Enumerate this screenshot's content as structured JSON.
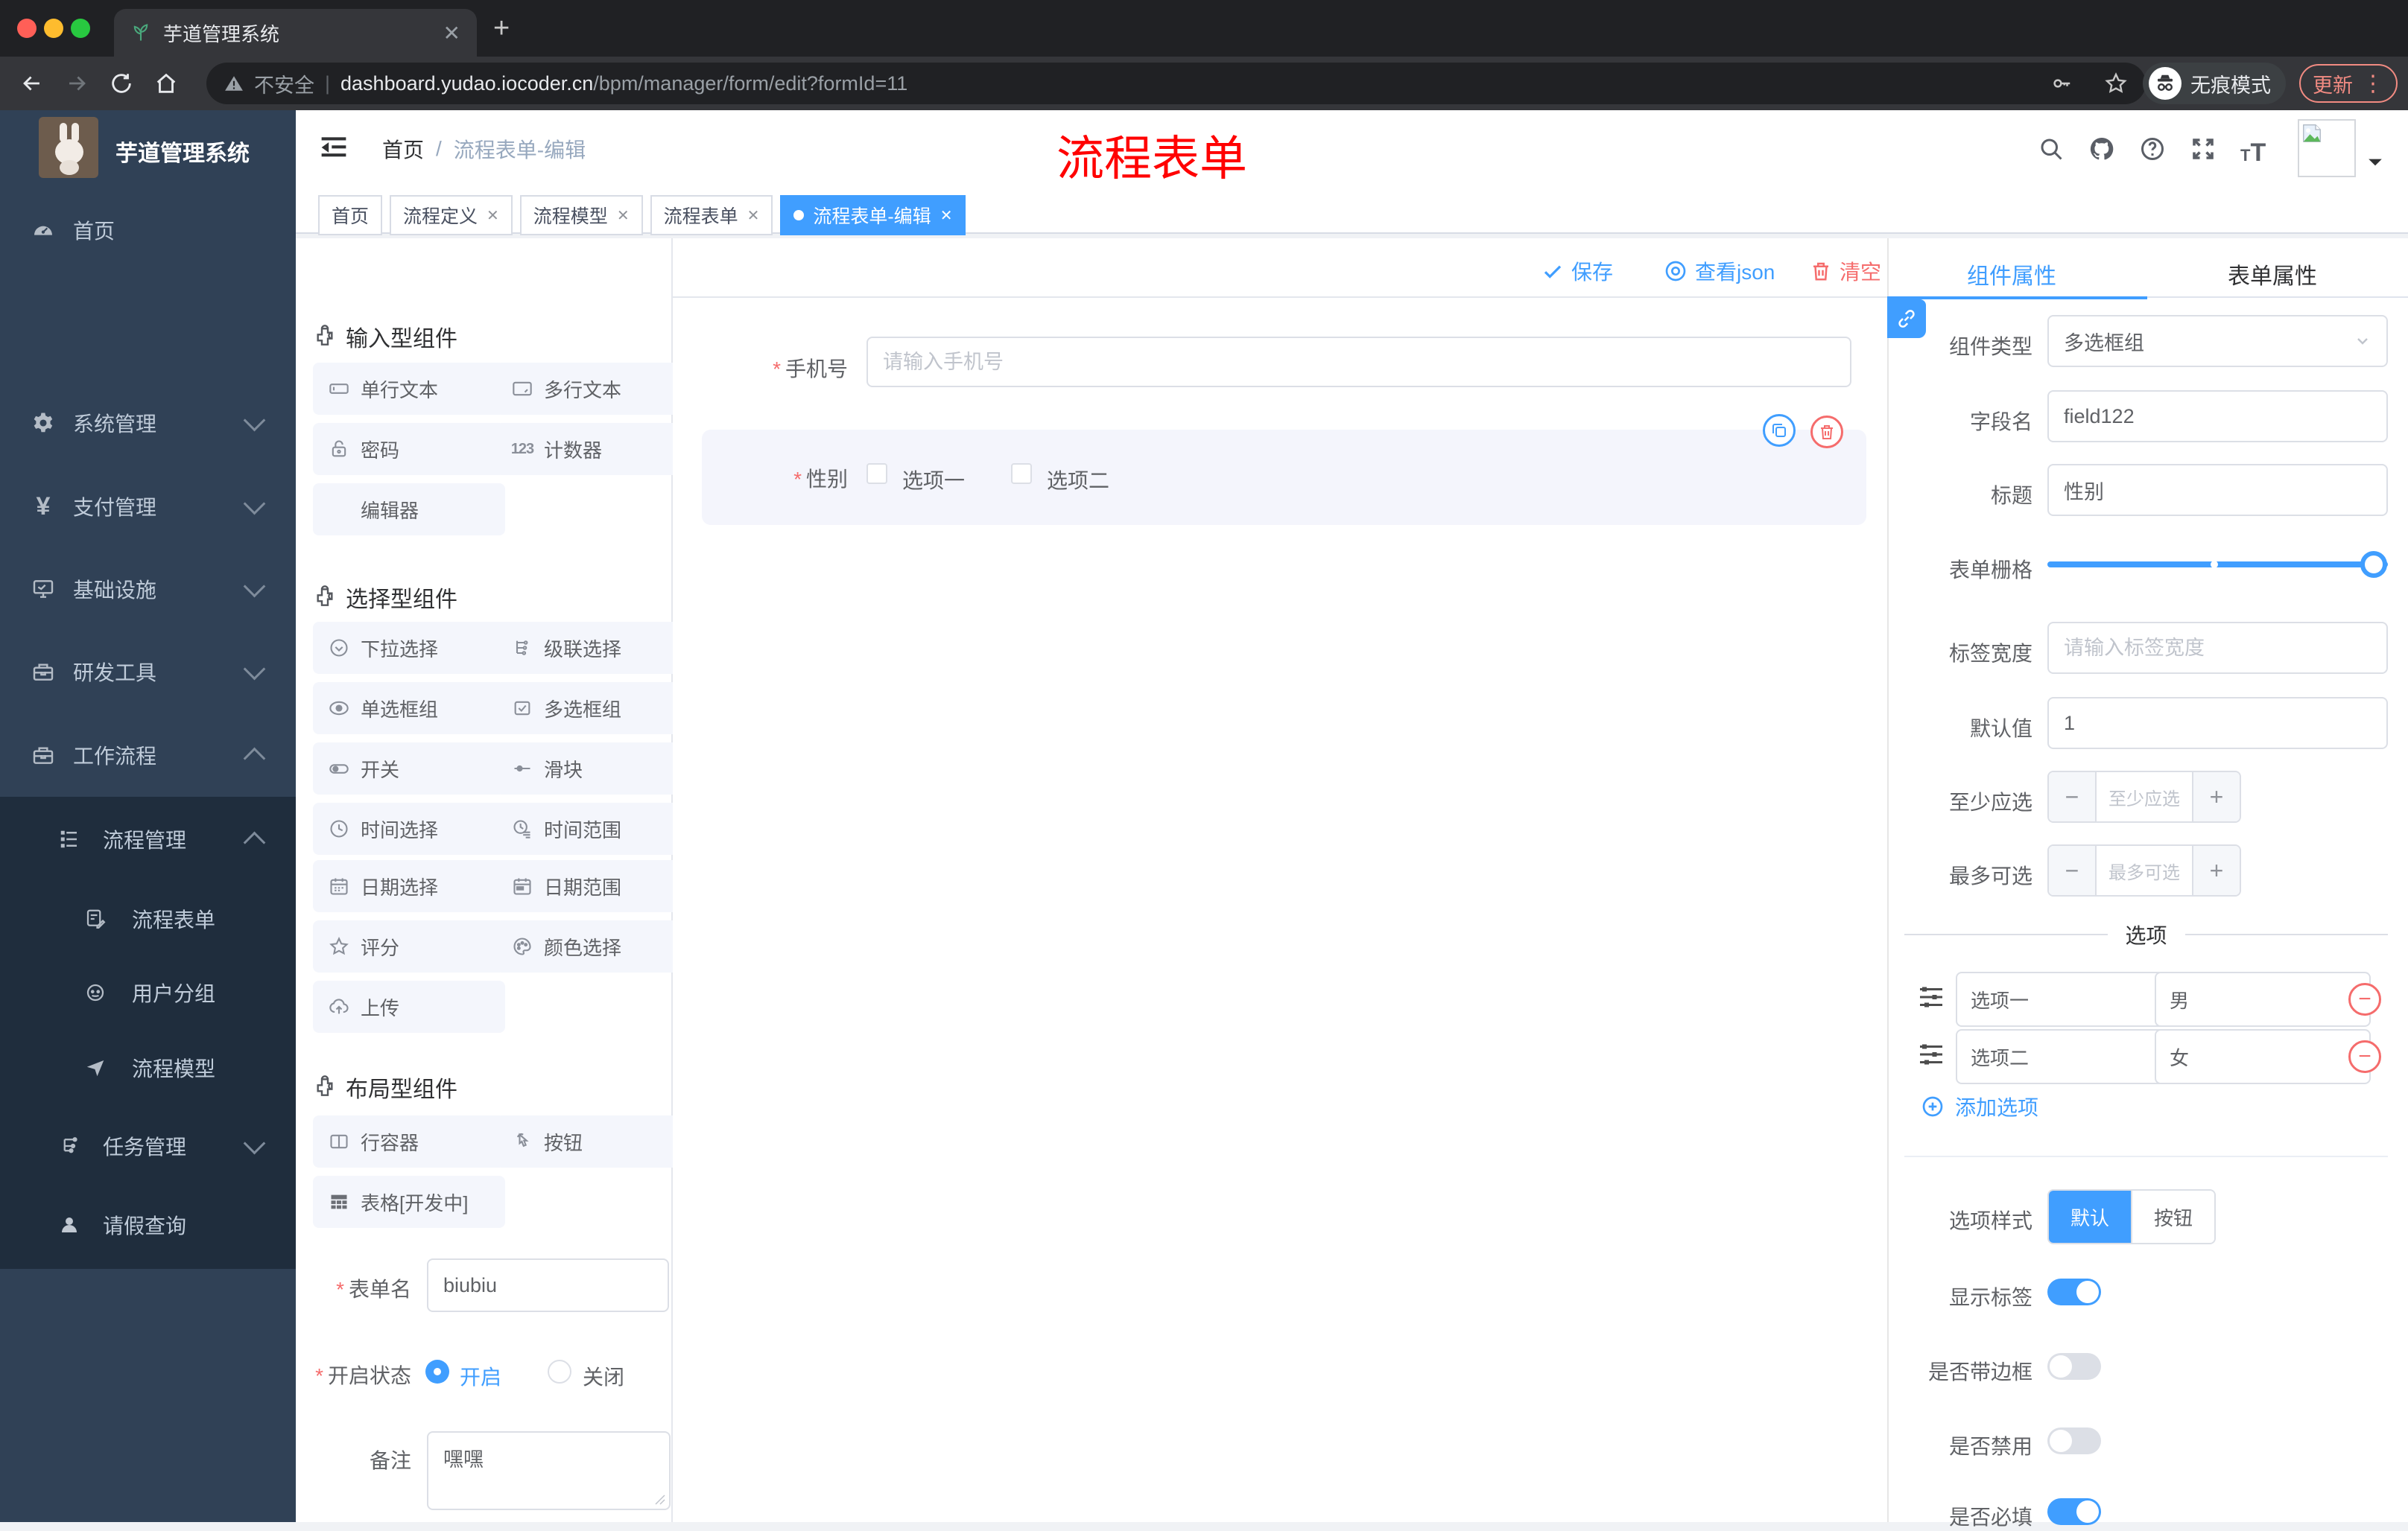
{
  "browser": {
    "tab_title": "芋道管理系统",
    "insecure_label": "不安全",
    "url_domain": "dashboard.yudao.iocoder.cn",
    "url_path": "/bpm/manager/form/edit?formId=11",
    "incognito_label": "无痕模式",
    "update_label": "更新"
  },
  "sidebar": {
    "logo_title": "芋道管理系统",
    "items": [
      {
        "label": "首页"
      },
      {
        "label": "系统管理"
      },
      {
        "label": "支付管理"
      },
      {
        "label": "基础设施"
      },
      {
        "label": "研发工具"
      },
      {
        "label": "工作流程"
      }
    ],
    "sub_items": [
      {
        "label": "流程管理"
      },
      {
        "label": "流程表单"
      },
      {
        "label": "用户分组"
      },
      {
        "label": "流程模型"
      },
      {
        "label": "任务管理"
      },
      {
        "label": "请假查询"
      }
    ]
  },
  "header": {
    "breadcrumb_home": "首页",
    "breadcrumb_sep": "/",
    "breadcrumb_current": "流程表单-编辑",
    "watermark": "流程表单"
  },
  "tagbar": {
    "tabs": [
      {
        "label": "首页"
      },
      {
        "label": "流程定义"
      },
      {
        "label": "流程模型"
      },
      {
        "label": "流程表单"
      },
      {
        "label": "流程表单-编辑"
      }
    ]
  },
  "toolbar": {
    "title": "流程表单",
    "save_label": "保存",
    "view_json_label": "查看json",
    "clear_label": "清空"
  },
  "components": {
    "section_input": "输入型组件",
    "section_select": "选择型组件",
    "section_layout": "布局型组件",
    "single_text": "单行文本",
    "multi_text": "多行文本",
    "password": "密码",
    "counter": "计数器",
    "editor": "编辑器",
    "dropdown": "下拉选择",
    "cascader": "级联选择",
    "radio_group": "单选框组",
    "checkbox_group": "多选框组",
    "switch": "开关",
    "slider": "滑块",
    "time_picker": "时间选择",
    "time_range": "时间范围",
    "date_picker": "日期选择",
    "date_range": "日期范围",
    "rate": "评分",
    "color_picker": "颜色选择",
    "upload": "上传",
    "row_container": "行容器",
    "button": "按钮",
    "table_dev": "表格[开发中]"
  },
  "form_meta": {
    "name_label": "表单名",
    "name_value": "biubiu",
    "status_label": "开启状态",
    "status_on": "开启",
    "status_off": "关闭",
    "remark_label": "备注",
    "remark_value": "嘿嘿"
  },
  "canvas": {
    "phone_label": "手机号",
    "phone_placeholder": "请输入手机号",
    "gender_label": "性别",
    "option1": "选项一",
    "option2": "选项二"
  },
  "props": {
    "tab_component": "组件属性",
    "tab_form": "表单属性",
    "type_label": "组件类型",
    "type_value": "多选框组",
    "field_label": "字段名",
    "field_value": "field122",
    "title_label": "标题",
    "title_value": "性别",
    "grid_label": "表单栅格",
    "width_label": "标签宽度",
    "width_placeholder": "请输入标签宽度",
    "default_label": "默认值",
    "default_value": "1",
    "min_label": "至少应选",
    "min_placeholder": "至少应选",
    "max_label": "最多可选",
    "max_placeholder": "最多可选",
    "options_title": "选项",
    "opt1_label": "选项一",
    "opt1_value": "男",
    "opt2_label": "选项二",
    "opt2_value": "女",
    "add_option": "添加选项",
    "style_label": "选项样式",
    "style_default": "默认",
    "style_button": "按钮",
    "show_label": "显示标签",
    "border_label": "是否带边框",
    "disabled_label": "是否禁用",
    "required_label": "是否必填"
  },
  "colors": {
    "primary": "#409eff",
    "danger": "#f56c6c",
    "sidebar_bg": "#304156",
    "submenu_bg": "#1f2d3d",
    "watermark_red": "#ff0000"
  }
}
